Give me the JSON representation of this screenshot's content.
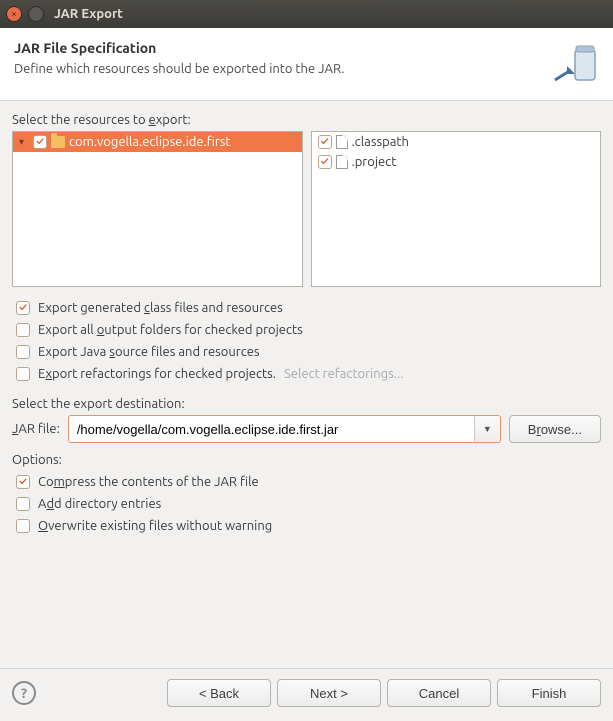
{
  "window": {
    "title": "JAR Export"
  },
  "header": {
    "title": "JAR File Specification",
    "subtitle": "Define which resources should be exported into the JAR."
  },
  "resources": {
    "label_pre": "Select the resources to ",
    "label_u": "e",
    "label_post": "xport:",
    "project": "com.vogella.eclipse.ide.first",
    "files": [
      ".classpath",
      ".project"
    ]
  },
  "export_opts": {
    "class_files": "Export generated class files and resources",
    "output_folders": "Export all output folders for checked projects",
    "java_source": "Export Java source files and resources",
    "refactorings": "Export refactorings for checked projects.",
    "refactorings_link": "Select refactorings..."
  },
  "destination": {
    "label": "Select the export destination:",
    "field_label": "JAR file:",
    "value": "/home/vogella/com.vogella.eclipse.ide.first.jar",
    "browse": "Browse..."
  },
  "options": {
    "label": "Options:",
    "compress": "Compress the contents of the JAR file",
    "add_dir": "Add directory entries",
    "overwrite": "Overwrite existing files without warning"
  },
  "buttons": {
    "back": "< Back",
    "next": "Next >",
    "cancel": "Cancel",
    "finish": "Finish"
  }
}
